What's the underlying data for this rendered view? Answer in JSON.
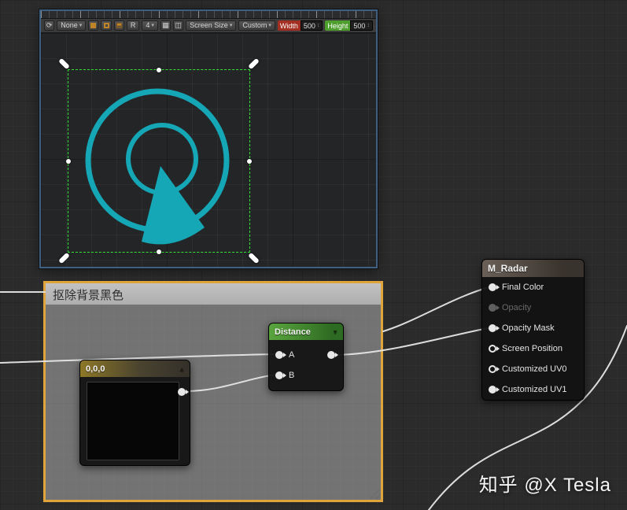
{
  "colors": {
    "radar_teal": "#15a7b5",
    "selection_green": "#35e335",
    "comment_border": "#dfa43c",
    "wire": "#e6e6e6",
    "designer_border": "#3f6080",
    "width_badge": "#a32e22",
    "height_badge": "#4e9e2d"
  },
  "icons": {
    "rotate": "⟳",
    "caret_down": "▾",
    "grid": "▦",
    "panel": "◫",
    "spinner": "↕",
    "collapse_up": "▲",
    "collapse_down": "▼"
  },
  "designer": {
    "toolbar": {
      "none": "None",
      "r": "R",
      "grid_snap": "4",
      "screen_size": "Screen Size",
      "custom": "Custom",
      "width_label": "Width",
      "width_value": "500",
      "height_label": "Height",
      "height_value": "500"
    }
  },
  "graph": {
    "comment": {
      "title": "抠除背景黑色"
    },
    "nodes": {
      "distance": {
        "title": "Distance",
        "pins": [
          "A",
          "B"
        ]
      },
      "constant": {
        "title": "0,0,0"
      },
      "result": {
        "title": "M_Radar",
        "pins": [
          "Final Color",
          "Opacity",
          "Opacity Mask",
          "Screen Position",
          "Customized UV0",
          "Customized UV1"
        ]
      }
    }
  },
  "watermark": "知乎 @X Tesla"
}
